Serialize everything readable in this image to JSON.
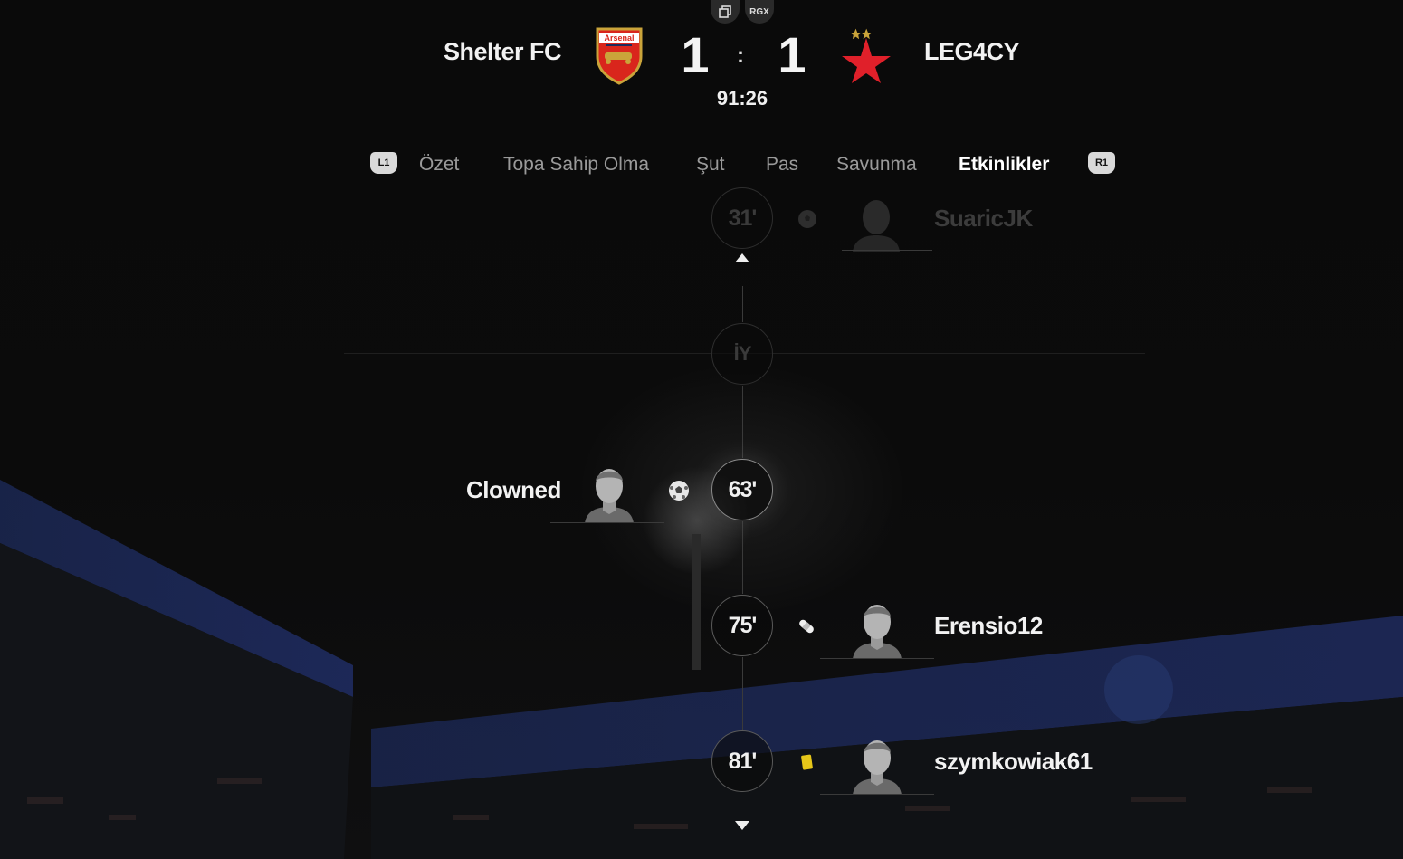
{
  "top_buttons": {
    "rgx_label": "RGX"
  },
  "match": {
    "home": {
      "name": "Shelter FC",
      "score": "1",
      "crest_text": "Arsenal"
    },
    "away": {
      "name": "LEG4CY",
      "score": "1"
    },
    "separator": ":",
    "clock": "91:26"
  },
  "tabs": {
    "left_shoulder": "L1",
    "right_shoulder": "R1",
    "items": [
      {
        "label": "Özet",
        "active": false
      },
      {
        "label": "Topa Sahip Olma",
        "active": false
      },
      {
        "label": "Şut",
        "active": false
      },
      {
        "label": "Pas",
        "active": false
      },
      {
        "label": "Savunma",
        "active": false
      },
      {
        "label": "Etkinlikler",
        "active": true
      }
    ]
  },
  "events": [
    {
      "minute": "31'",
      "side": "away",
      "type": "goal",
      "player": "SuaricJK",
      "faded": true
    },
    {
      "minute": "İY",
      "side": "center",
      "type": "half-time",
      "player": "",
      "faded": true
    },
    {
      "minute": "63'",
      "side": "home",
      "type": "goal",
      "player": "Clowned",
      "faded": false
    },
    {
      "minute": "75'",
      "side": "away",
      "type": "injury",
      "player": "Erensio12",
      "faded": false
    },
    {
      "minute": "81'",
      "side": "away",
      "type": "yellow-card",
      "player": "szymkowiak61",
      "faded": false
    }
  ],
  "colors": {
    "accent_text": "#ffffff",
    "inactive_tab": "#9a9a9a",
    "yellow_card": "#e6c619",
    "home_crest_red": "#d9261c",
    "away_star_red": "#e0202a"
  }
}
